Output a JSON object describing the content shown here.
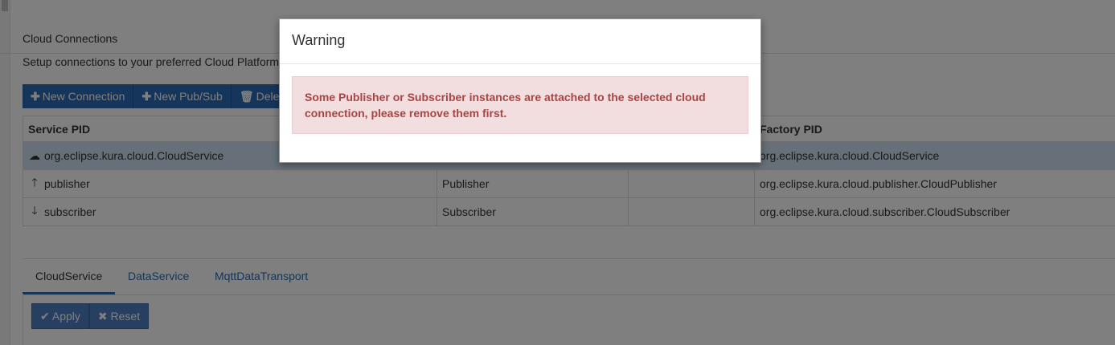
{
  "page": {
    "title": "Cloud Connections",
    "subtitle": "Setup connections to your preferred Cloud Platform"
  },
  "toolbar": {
    "new_connection": "New Connection",
    "new_pubsub": "New Pub/Sub",
    "delete": "Delete"
  },
  "table": {
    "headers": [
      "Service PID",
      "",
      "",
      "Factory PID"
    ],
    "rows": [
      {
        "icon": "cloud-icon",
        "pid": "org.eclipse.kura.cloud.CloudService",
        "type": "",
        "extra": "",
        "factory": "org.eclipse.kura.cloud.CloudService",
        "selected": true
      },
      {
        "icon": "arrow-up-icon",
        "pid": "publisher",
        "type": "Publisher",
        "extra": "",
        "factory": "org.eclipse.kura.cloud.publisher.CloudPublisher",
        "selected": false
      },
      {
        "icon": "arrow-down-icon",
        "pid": "subscriber",
        "type": "Subscriber",
        "extra": "",
        "factory": "org.eclipse.kura.cloud.subscriber.CloudSubscriber",
        "selected": false
      }
    ]
  },
  "tabs": [
    "CloudService",
    "DataService",
    "MqttDataTransport"
  ],
  "actions": {
    "apply": "Apply",
    "reset": "Reset"
  },
  "modal": {
    "title": "Warning",
    "message": "Some Publisher or Subscriber instances are attached to the selected cloud connection, please remove them first."
  },
  "colors": {
    "primary": "#2a6ab4",
    "alert_bg": "#f2dede",
    "alert_text": "#a94442",
    "selected_row": "#cfe0f3"
  }
}
